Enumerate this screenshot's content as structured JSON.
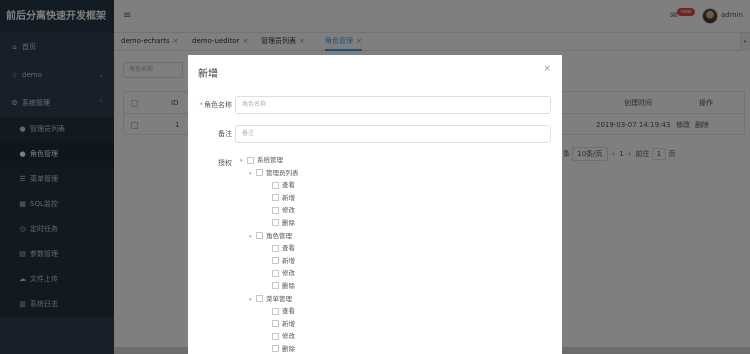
{
  "app": {
    "title": "前后分离快速开发框架"
  },
  "sidebar": {
    "items": [
      {
        "label": "首页",
        "icon": "home-icon",
        "glyph": "⌂"
      },
      {
        "label": "demo",
        "icon": "star-icon",
        "glyph": "☆"
      },
      {
        "label": "系统管理",
        "icon": "settings-icon",
        "glyph": "⚙"
      },
      {
        "label": "管理员列表",
        "icon": "user-icon",
        "glyph": "●"
      },
      {
        "label": "角色管理",
        "icon": "user-role-icon",
        "glyph": "●"
      },
      {
        "label": "菜单管理",
        "icon": "menu-list-icon",
        "glyph": "☰"
      },
      {
        "label": "SQL监控",
        "icon": "sql-monitor-icon",
        "glyph": "▦"
      },
      {
        "label": "定时任务",
        "icon": "clock-icon",
        "glyph": "◷"
      },
      {
        "label": "参数管理",
        "icon": "params-icon",
        "glyph": "▤"
      },
      {
        "label": "文件上传",
        "icon": "upload-icon",
        "glyph": "☁"
      },
      {
        "label": "系统日志",
        "icon": "log-icon",
        "glyph": "▥"
      }
    ]
  },
  "header": {
    "menu_glyph": "≡",
    "bell_glyph": "✉",
    "badge": "new",
    "username": "admin"
  },
  "tabs": [
    {
      "label": "demo-echarts",
      "close": "×"
    },
    {
      "label": "demo-ueditor",
      "close": "×"
    },
    {
      "label": "管理员列表",
      "close": "×"
    },
    {
      "label": "角色管理",
      "close": "×"
    }
  ],
  "tab_scroll_glyph": "▸",
  "background": {
    "search_placeholder": "角色名称",
    "columns": [
      "ID",
      "创建时间",
      "操作"
    ],
    "row": {
      "id": "1",
      "created": "2019-03-07 14:19:43",
      "edit": "修改",
      "delete": "删除"
    },
    "pager": {
      "total_suffix": "条",
      "page_size": "10条/页",
      "prev": "‹",
      "page": "1",
      "next": "›",
      "goto": "前往",
      "goto_value": "1",
      "page_unit": "页"
    }
  },
  "modal": {
    "title": "新增",
    "close_glyph": "×",
    "role_name_label": "角色名称",
    "required_mark": "*",
    "role_name_placeholder": "角色名称",
    "remark_label": "备注",
    "remark_placeholder": "备注",
    "auth_label": "授权",
    "tree": [
      {
        "level": 1,
        "caret": "▾",
        "label": "系统管理"
      },
      {
        "level": 2,
        "caret": "▾",
        "label": "管理员列表"
      },
      {
        "level": 3,
        "label": "查看"
      },
      {
        "level": 3,
        "label": "新增"
      },
      {
        "level": 3,
        "label": "修改"
      },
      {
        "level": 3,
        "label": "删除"
      },
      {
        "level": 2,
        "caret": "▾",
        "label": "角色管理"
      },
      {
        "level": 3,
        "label": "查看"
      },
      {
        "level": 3,
        "label": "新增"
      },
      {
        "level": 3,
        "label": "修改"
      },
      {
        "level": 3,
        "label": "删除"
      },
      {
        "level": 2,
        "caret": "▾",
        "label": "菜单管理"
      },
      {
        "level": 3,
        "label": "查看"
      },
      {
        "level": 3,
        "label": "新增"
      },
      {
        "level": 3,
        "label": "修改"
      },
      {
        "level": 3,
        "label": "删除"
      }
    ]
  },
  "colors": {
    "sidebar": "#2f4050",
    "accent": "#409eff",
    "required": "#f56c6c",
    "badge": "#e04848"
  }
}
